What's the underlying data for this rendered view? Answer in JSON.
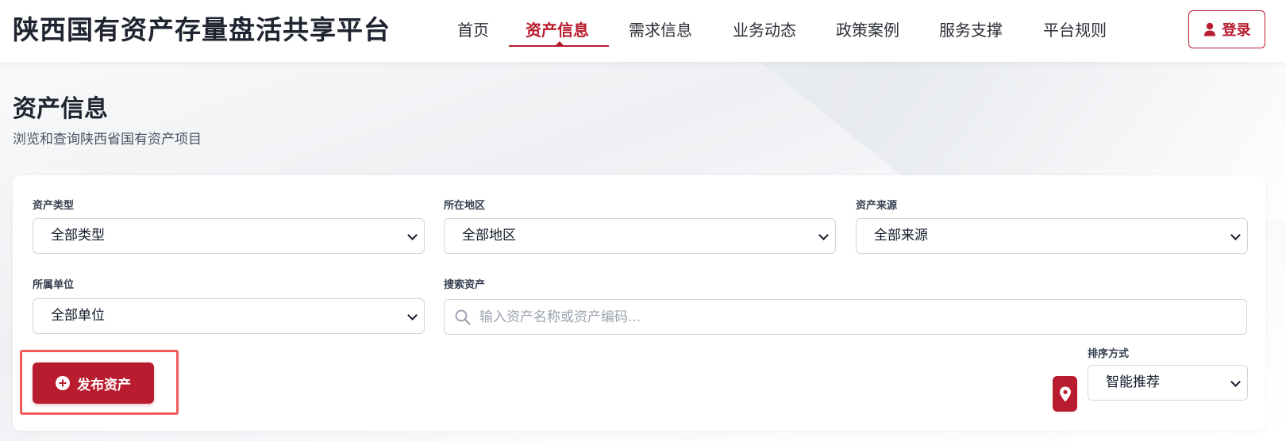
{
  "header": {
    "logo": "陕西国有资产存量盘活共享平台",
    "nav": [
      {
        "label": "首页",
        "active": false
      },
      {
        "label": "资产信息",
        "active": true
      },
      {
        "label": "需求信息",
        "active": false
      },
      {
        "label": "业务动态",
        "active": false
      },
      {
        "label": "政策案例",
        "active": false
      },
      {
        "label": "服务支撑",
        "active": false
      },
      {
        "label": "平台规则",
        "active": false
      }
    ],
    "login_label": "登录"
  },
  "hero": {
    "title": "资产信息",
    "subtitle": "浏览和查询陕西省国有资产项目"
  },
  "filters": {
    "asset_type": {
      "label": "资产类型",
      "value": "全部类型"
    },
    "region": {
      "label": "所在地区",
      "value": "全部地区"
    },
    "source": {
      "label": "资产来源",
      "value": "全部来源"
    },
    "unit": {
      "label": "所属单位",
      "value": "全部单位"
    },
    "search": {
      "label": "搜索资产",
      "placeholder": "输入资产名称或资产编码..."
    },
    "sort": {
      "label": "排序方式",
      "value": "智能推荐"
    }
  },
  "actions": {
    "publish_label": "发布资产"
  },
  "colors": {
    "brand": "#b91c2e",
    "highlight": "#f15a5a"
  }
}
